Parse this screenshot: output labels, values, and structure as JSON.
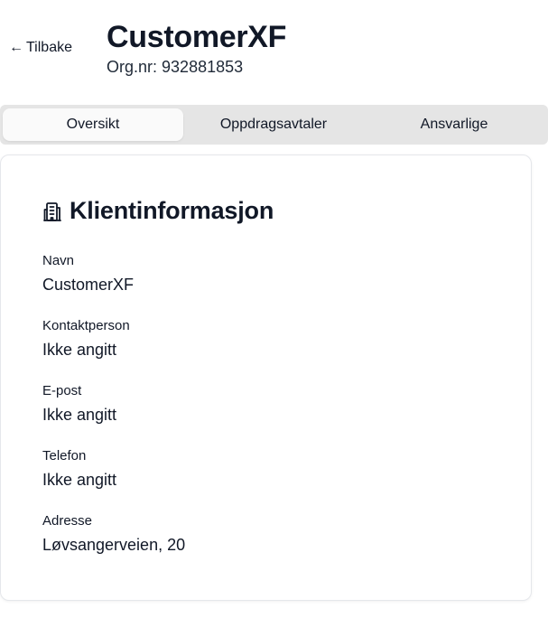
{
  "header": {
    "back_arrow": "←",
    "back_label": "Tilbake",
    "title": "CustomerXF",
    "org_label": "Org.nr:",
    "org_number": "932881853"
  },
  "tabs": [
    {
      "label": "Oversikt",
      "active": true
    },
    {
      "label": "Oppdragsavtaler",
      "active": false
    },
    {
      "label": "Ansvarlige",
      "active": false
    }
  ],
  "client_info": {
    "icon": "building-icon",
    "title": "Klientinformasjon",
    "fields": [
      {
        "label": "Navn",
        "value": "CustomerXF"
      },
      {
        "label": "Kontaktperson",
        "value": "Ikke angitt"
      },
      {
        "label": "E-post",
        "value": "Ikke angitt"
      },
      {
        "label": "Telefon",
        "value": "Ikke angitt"
      },
      {
        "label": "Adresse",
        "value": "Løvsangerveien, 20"
      }
    ]
  },
  "colors": {
    "tab_bar_bg": "#e5e5e5",
    "active_tab_bg": "#fafafa",
    "text": "#111827",
    "card_border": "#e5e7eb"
  }
}
